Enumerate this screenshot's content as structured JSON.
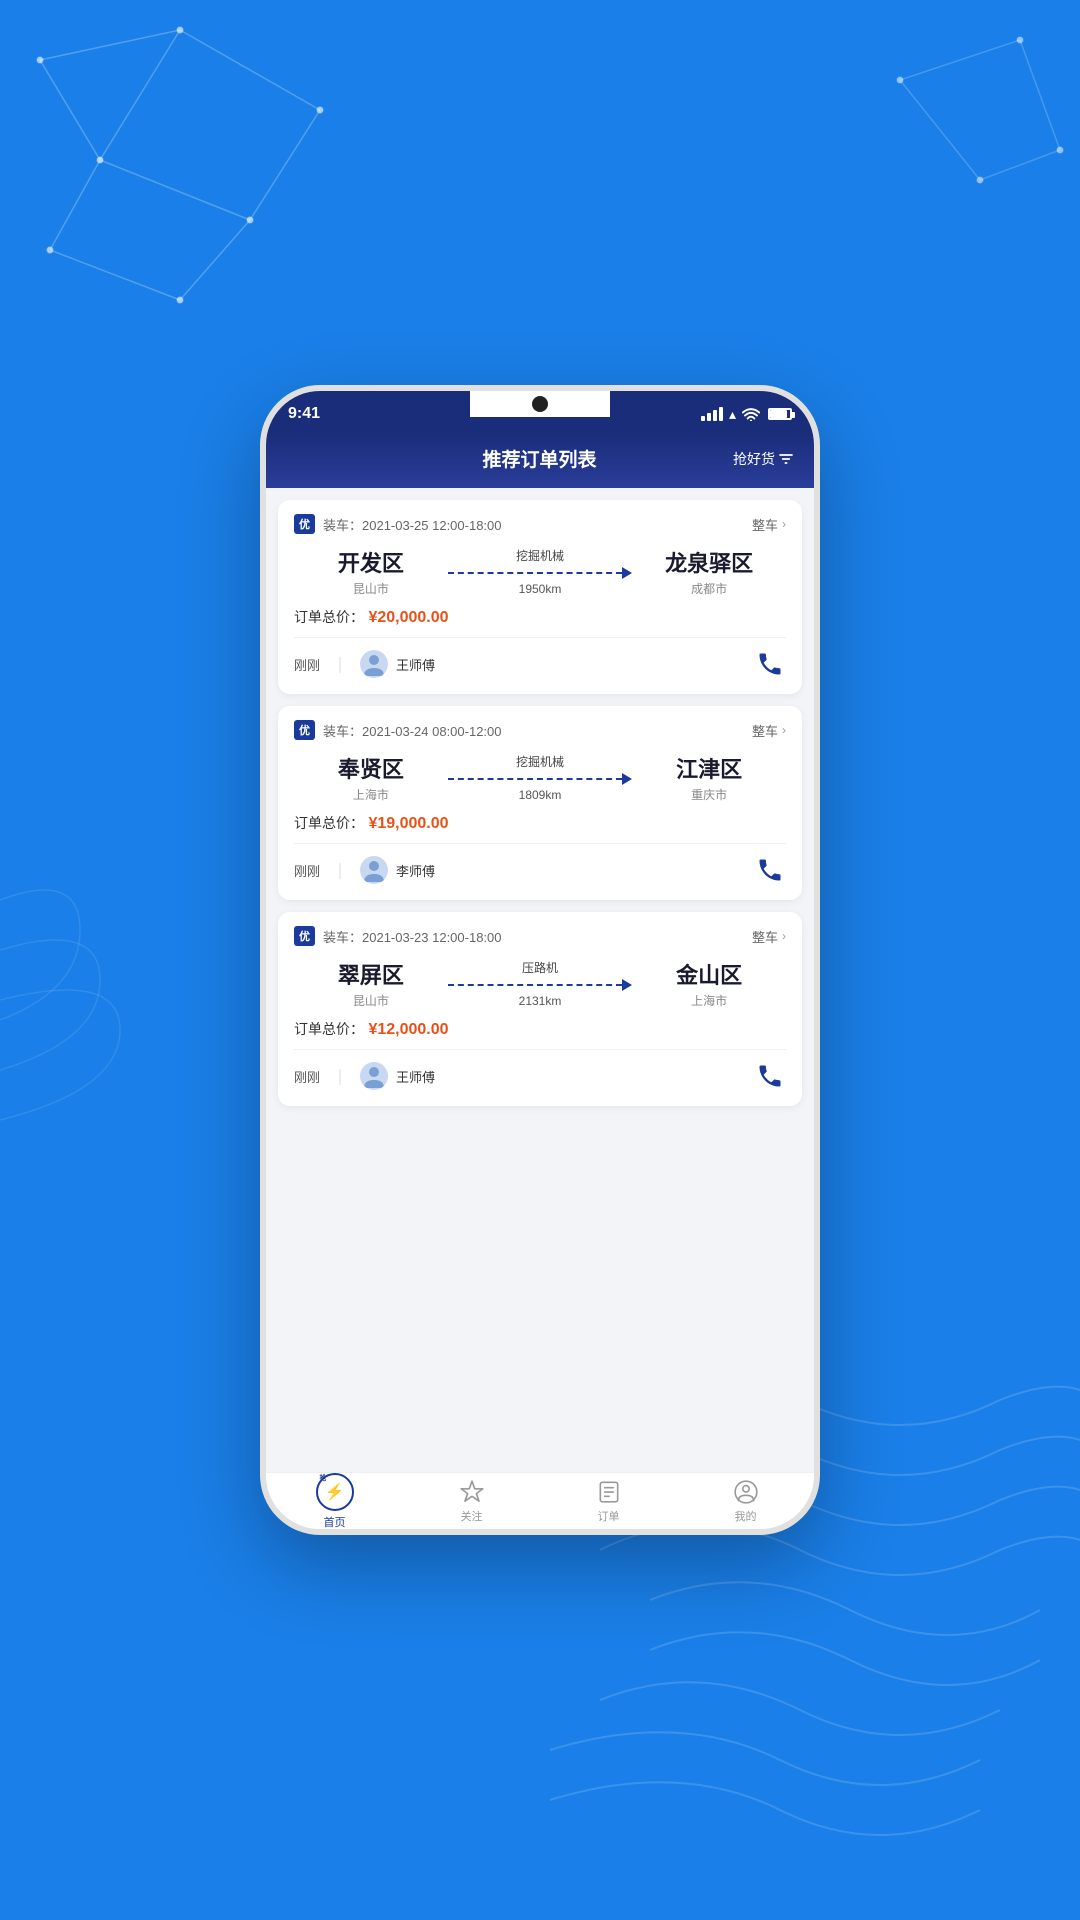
{
  "background": "#1a7fe8",
  "statusBar": {
    "time": "9:41",
    "icons": [
      "signal",
      "wifi",
      "battery"
    ]
  },
  "header": {
    "title": "推荐订单列表",
    "actionLabel": "抢好货",
    "actionIcon": "filter-icon"
  },
  "orders": [
    {
      "id": "order-1",
      "badge": "优",
      "loadTime": "装车：2021-03-25 12:00-18:00",
      "type": "整车",
      "origin": {
        "city": "开发区",
        "province": "昆山市"
      },
      "destination": {
        "city": "龙泉驿区",
        "province": "成都市"
      },
      "cargo": "挖掘机械",
      "distance": "1950km",
      "priceLabel": "订单总价：",
      "price": "¥20,000.00",
      "driverTime": "刚刚",
      "driverName": "王师傅"
    },
    {
      "id": "order-2",
      "badge": "优",
      "loadTime": "装车：2021-03-24 08:00-12:00",
      "type": "整车",
      "origin": {
        "city": "奉贤区",
        "province": "上海市"
      },
      "destination": {
        "city": "江津区",
        "province": "重庆市"
      },
      "cargo": "挖掘机械",
      "distance": "1809km",
      "priceLabel": "订单总价：",
      "price": "¥19,000.00",
      "driverTime": "刚刚",
      "driverName": "李师傅"
    },
    {
      "id": "order-3",
      "badge": "优",
      "loadTime": "装车：2021-03-23 12:00-18:00",
      "type": "整车",
      "origin": {
        "city": "翠屏区",
        "province": "昆山市"
      },
      "destination": {
        "city": "金山区",
        "province": "上海市"
      },
      "cargo": "压路机",
      "distance": "2131km",
      "priceLabel": "订单总价：",
      "price": "¥12,000.00",
      "driverTime": "刚刚",
      "driverName": "王师傅"
    }
  ],
  "bottomNav": [
    {
      "id": "home",
      "label": "首页",
      "active": true
    },
    {
      "id": "follow",
      "label": "关注",
      "active": false
    },
    {
      "id": "orders",
      "label": "订单",
      "active": false
    },
    {
      "id": "mine",
      "label": "我的",
      "active": false
    }
  ]
}
